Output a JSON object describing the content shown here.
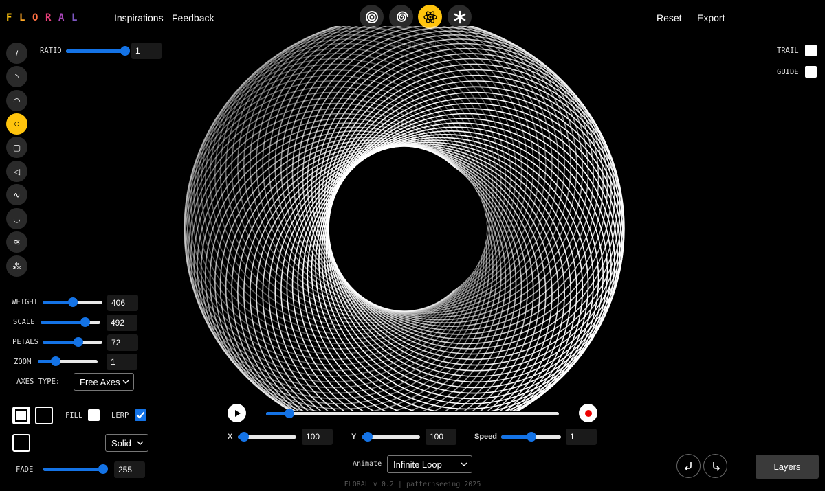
{
  "app": {
    "logo_letters": [
      "F",
      "L",
      "O",
      "R",
      "A",
      "L"
    ],
    "logo_colors": [
      "#ffc40d",
      "#ffa726",
      "#ff7043",
      "#ec407a",
      "#ab47bc",
      "#7e57c2"
    ],
    "accent_color": "#1473e6",
    "active_color": "#ffc40d"
  },
  "nav": {
    "inspirations": "Inspirations",
    "feedback": "Feedback",
    "reset": "Reset",
    "export": "Export"
  },
  "mode_buttons": [
    {
      "icon": "concentric-circles-icon",
      "active": false
    },
    {
      "icon": "spiral-icon",
      "active": false
    },
    {
      "icon": "atom-icon",
      "active": true
    },
    {
      "icon": "asterisk-icon",
      "active": false
    }
  ],
  "tools": [
    {
      "icon": "line-icon",
      "glyph": "/",
      "active": false
    },
    {
      "icon": "arc-small-icon",
      "glyph": "◝",
      "active": false
    },
    {
      "icon": "arc-icon",
      "glyph": "◠",
      "active": false
    },
    {
      "icon": "circle-icon",
      "glyph": "○",
      "active": true
    },
    {
      "icon": "square-icon",
      "glyph": "▢",
      "active": false
    },
    {
      "icon": "triangle-icon",
      "glyph": "◁",
      "active": false
    },
    {
      "icon": "wave-icon",
      "glyph": "∿",
      "active": false
    },
    {
      "icon": "curve-icon",
      "glyph": "◡",
      "active": false
    },
    {
      "icon": "noise-wave-icon",
      "glyph": "≋",
      "active": false
    },
    {
      "icon": "particles-icon",
      "glyph": "⁂",
      "active": false
    }
  ],
  "controls": {
    "ratio": {
      "label": "RATIO",
      "value": "1",
      "level": 1.0
    },
    "weight": {
      "label": "WEIGHT",
      "value": "406",
      "level": 0.5
    },
    "scale": {
      "label": "SCALE",
      "value": "492",
      "level": 0.75
    },
    "petals": {
      "label": "PETALS",
      "value": "72",
      "level": 0.6
    },
    "zoom": {
      "label": "ZOOM",
      "value": "1",
      "level": 0.3
    },
    "axes_type": {
      "label": "AXES TYPE:",
      "value": "Free Axes"
    },
    "fill": {
      "label": "FILL",
      "checked": false
    },
    "lerp": {
      "label": "LERP",
      "checked": true
    },
    "stroke_style": {
      "value": "Solid"
    },
    "fade": {
      "label": "FADE",
      "value": "255",
      "level": 1.0
    }
  },
  "toggles": {
    "trail": {
      "label": "TRAIL",
      "checked": false
    },
    "guide": {
      "label": "GUIDE",
      "checked": false
    }
  },
  "playback": {
    "progress": 0.08,
    "x": {
      "label": "X",
      "value": "100",
      "level": 0.1
    },
    "y": {
      "label": "Y",
      "value": "100",
      "level": 0.1
    },
    "speed": {
      "label": "Speed",
      "value": "1",
      "level": 0.5
    },
    "animate_label": "Animate",
    "animate_value": "Infinite Loop"
  },
  "layers_label": "Layers",
  "footer": "FLORAL v 0.2 | patternseeing 2025",
  "canvas_title": "Generate Floral"
}
